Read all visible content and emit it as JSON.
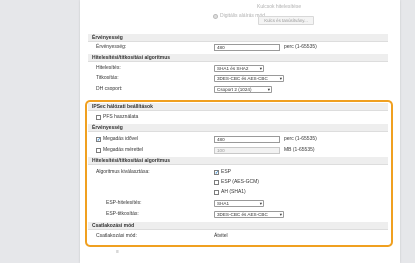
{
  "top": {
    "faded_title": "Kulcsok hitelesítése",
    "radio_label": "Digitális aláírás mód",
    "ghost_button": "Kulcs és tanúsítvány..."
  },
  "validity": {
    "header": "Érvényesség",
    "label": "Érvényesség:",
    "value": "480",
    "unit": "perc (1-65535)"
  },
  "auth_enc": {
    "header": "Hitelesítési/titkosítási algoritmus",
    "auth_label": "Hitelesítés:",
    "auth_value": "SHA1 és SHA2",
    "enc_label": "Titkosítás:",
    "enc_value": "3DES-CBC és AES-CBC",
    "dh_label": "DH csoport:",
    "dh_value": "Csoport 2 (1024)"
  },
  "ipsec": {
    "header": "IPSec hálózati beállítások",
    "pfs_label": "PFS használata",
    "validity_header": "Érvényesség",
    "time_label": "Megadás idővel",
    "time_value": "480",
    "time_unit": "perc (1-65535)",
    "size_label": "Megadás mérettel",
    "size_value": "100",
    "size_unit": "MB (1-65535)",
    "alg_header": "Hitelesítési/titkosítási algoritmus",
    "alg_choice_label": "Algoritmus kiválasztása:",
    "esp_label": "ESP",
    "esp_aes_gcm_label": "ESP (AES-GCM)",
    "ah_label": "AH (SHA1)",
    "esp_auth_label": "ESP-hitelesítés:",
    "esp_auth_value": "SHA1",
    "esp_enc_label": "ESP-titkosítás:",
    "esp_enc_value": "3DES-CBC és AES-CBC",
    "conn_header": "Csatlakozási mód",
    "conn_label": "Csatlakozási mód:",
    "conn_value": "Átvitel"
  },
  "icons": {
    "chevron": "▾",
    "check": "✓",
    "bottom": "≡"
  },
  "colors": {
    "highlight": "#f0a020",
    "checkbox_mark": "#0a6ebd"
  }
}
